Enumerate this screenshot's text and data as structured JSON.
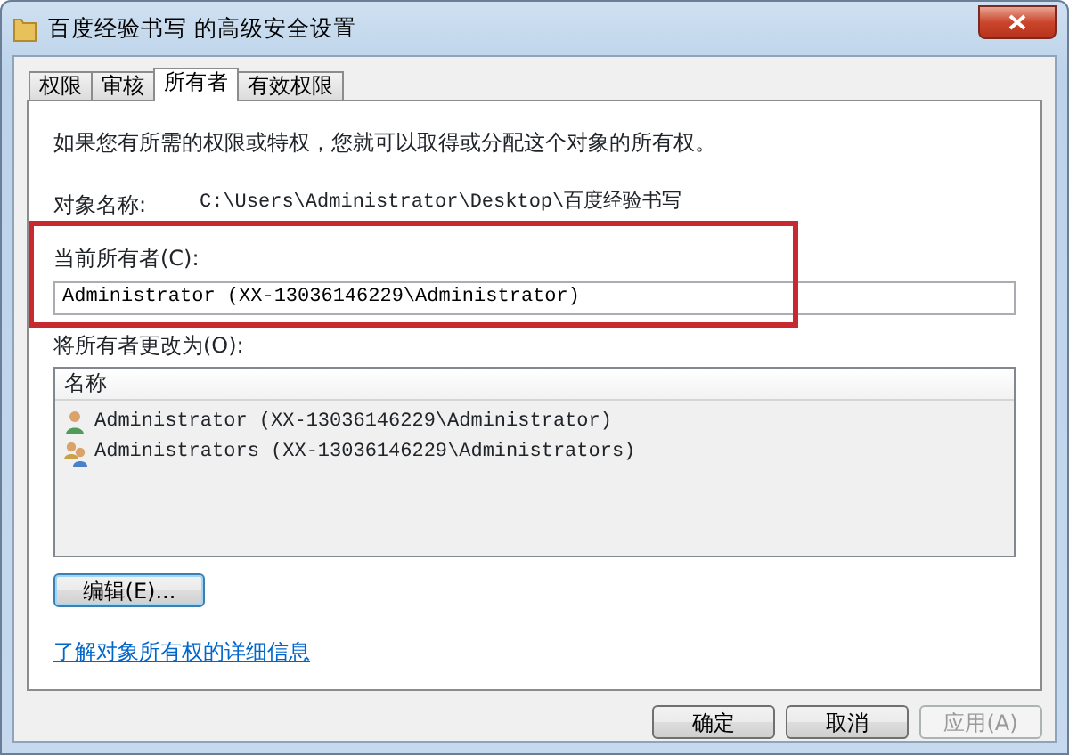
{
  "window": {
    "title": "百度经验书写 的高级安全设置"
  },
  "tabs": [
    {
      "label": "权限",
      "selected": false
    },
    {
      "label": "审核",
      "selected": false
    },
    {
      "label": "所有者",
      "selected": true
    },
    {
      "label": "有效权限",
      "selected": false
    }
  ],
  "intro": "如果您有所需的权限或特权，您就可以取得或分配这个对象的所有权。",
  "object_name": {
    "label": "对象名称:",
    "value": "C:\\Users\\Administrator\\Desktop\\百度经验书写"
  },
  "current_owner": {
    "label": "当前所有者(C):",
    "value": "Administrator (XX-13036146229\\Administrator)"
  },
  "change_owner": {
    "label": "将所有者更改为(O):",
    "column": "名称",
    "rows": [
      {
        "kind": "user",
        "name": "Administrator (XX-13036146229\\Administrator)"
      },
      {
        "kind": "group",
        "name": "Administrators (XX-13036146229\\Administrators)"
      }
    ]
  },
  "edit_button": "编辑(E)...",
  "help_link": "了解对象所有权的详细信息",
  "buttons": [
    {
      "label": "确定",
      "disabled": false
    },
    {
      "label": "取消",
      "disabled": false
    },
    {
      "label": "应用(A)",
      "disabled": true
    }
  ]
}
